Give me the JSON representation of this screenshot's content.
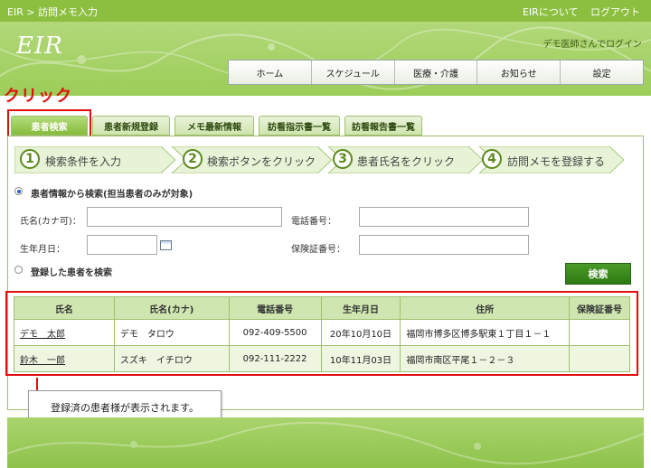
{
  "topbar": {
    "breadcrumb": "EIR > 訪問メモ入力",
    "about": "EIRについて",
    "logout": "ログアウト"
  },
  "header": {
    "logo": "EIR",
    "login_status": "デモ医師さんでログイン"
  },
  "nav": [
    "ホーム",
    "スケジュール",
    "医療・介護",
    "お知らせ",
    "設定"
  ],
  "annotation": {
    "click": "クリック",
    "callout": "登録済の患者様が表示されます。"
  },
  "tabs": [
    "患者検索",
    "患者新規登録",
    "メモ最新情報",
    "訪看指示書一覧",
    "訪看報告書一覧"
  ],
  "steps": [
    {
      "num": "1",
      "label": "検索条件を入力"
    },
    {
      "num": "2",
      "label": "検索ボタンをクリック"
    },
    {
      "num": "3",
      "label": "患者氏名をクリック"
    },
    {
      "num": "4",
      "label": "訪問メモを登録する"
    }
  ],
  "search": {
    "option1": "患者情報から検索(担当患者のみが対象)",
    "option2": "登録した患者を検索",
    "name_label": "氏名(カナ可)：",
    "phone_label": "電話番号：",
    "dob_label": "生年月日：",
    "insurance_label": "保険証番号：",
    "name_value": "",
    "phone_value": "",
    "dob_value": "",
    "insurance_value": "",
    "button": "検索"
  },
  "table": {
    "headers": [
      "氏名",
      "氏名(カナ)",
      "電話番号",
      "生年月日",
      "住所",
      "保険証番号"
    ],
    "rows": [
      [
        "デモ　太郎",
        "デモ　タロウ",
        "092-409-5500",
        "20年10月10日",
        "福岡市博多区博多駅東１丁目１－１",
        ""
      ],
      [
        "鈴木　一郎",
        "スズキ　イチロウ",
        "092-111-2222",
        "10年11月03日",
        "福岡市南区平尾１－２－３",
        ""
      ]
    ]
  },
  "colors": {
    "brand_green": "#8cbf3f",
    "highlight_red": "#e01010",
    "button_green": "#2e7a13"
  }
}
